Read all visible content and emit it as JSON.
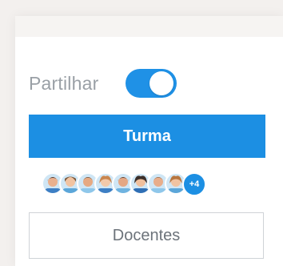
{
  "share": {
    "label": "Partilhar",
    "toggle_on": true
  },
  "buttons": {
    "turma_label": "Turma",
    "docentes_label": "Docentes"
  },
  "avatars": {
    "more_count_label": "+4"
  },
  "colors": {
    "accent": "#1c8fe3",
    "label_gray": "#9aa0a6"
  }
}
